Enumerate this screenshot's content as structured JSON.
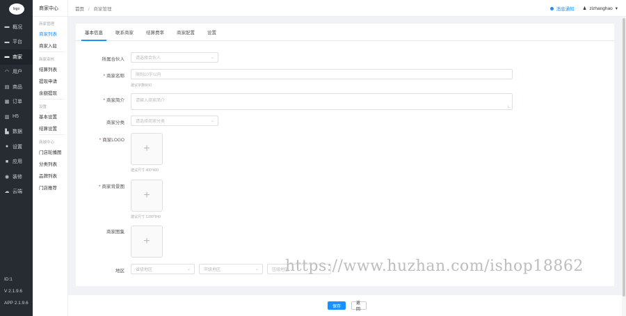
{
  "leftnav": {
    "logo_text": "logo",
    "items": [
      {
        "icon": "monitor-icon",
        "glyph": "▬",
        "label": "概况"
      },
      {
        "icon": "platform-icon",
        "glyph": "▬",
        "label": "平台"
      },
      {
        "icon": "merchant-icon",
        "glyph": "▬",
        "label": "商家"
      },
      {
        "icon": "user-icon",
        "glyph": "◠",
        "label": "用户"
      },
      {
        "icon": "goods-icon",
        "glyph": "▤",
        "label": "商品"
      },
      {
        "icon": "order-icon",
        "glyph": "▦",
        "label": "订单"
      },
      {
        "icon": "page-icon",
        "glyph": "▥",
        "label": "H5"
      },
      {
        "icon": "data-icon",
        "glyph": "▙",
        "label": "数据"
      },
      {
        "icon": "settings-icon",
        "glyph": "●",
        "label": "设置"
      },
      {
        "icon": "apps-icon",
        "glyph": "■",
        "label": "应用"
      },
      {
        "icon": "decor-icon",
        "glyph": "◉",
        "label": "装修"
      },
      {
        "icon": "cloud-icon",
        "glyph": "☁",
        "label": "云端"
      }
    ],
    "id_text": "ID:1",
    "version": "V 2.1.9.6",
    "app_version": "APP 2.1.9.6"
  },
  "submenu": {
    "title": "商家中心",
    "groups": [
      {
        "name": "商家管理",
        "items": [
          "商家列表",
          "商家入驻"
        ]
      },
      {
        "name": "商家审核",
        "items": [
          "结算列表",
          "提现申请",
          "余额提现"
        ]
      },
      {
        "name": "设置",
        "items": [
          "基本设置",
          "结算设置"
        ]
      },
      {
        "name": "商城中心",
        "items": [
          "门店轮播图",
          "分类列表",
          "品牌列表",
          "门店推荐"
        ]
      }
    ]
  },
  "header": {
    "crumb_home": "首页",
    "crumb_sep": "/",
    "crumb_current": "商家管理",
    "notify": "消息通知",
    "username": "zizhanghao",
    "caret": "▾"
  },
  "tabs": [
    "基本信息",
    "联系商家",
    "结算费率",
    "商家配置",
    "设置"
  ],
  "form": {
    "partner": {
      "label": "所属合伙人",
      "placeholder": "请选择合伙人"
    },
    "name": {
      "label": "商家名称",
      "placeholder": "限制10字以内",
      "hint": "建议字数8/30"
    },
    "intro": {
      "label": "商家简介",
      "placeholder": "请输入商家简介"
    },
    "category": {
      "label": "商家分类",
      "placeholder": "请选择商家分类"
    },
    "logo": {
      "label": "商家LOGO",
      "hint": "建议尺寸 400*400"
    },
    "bg": {
      "label": "商家背景图",
      "hint": "建议尺寸 1280*840"
    },
    "images": {
      "label": "商家图集"
    },
    "region": {
      "label": "地区",
      "province": "省级地区",
      "city": "市级地区",
      "district": "区级地区"
    }
  },
  "buttons": {
    "save": "保存",
    "back": "返回"
  },
  "watermark": "https://www.huzhan.com/ishop18862",
  "colors": {
    "accent": "#1890ff",
    "nav_bg": "#272c33",
    "required": "#f5222d"
  }
}
